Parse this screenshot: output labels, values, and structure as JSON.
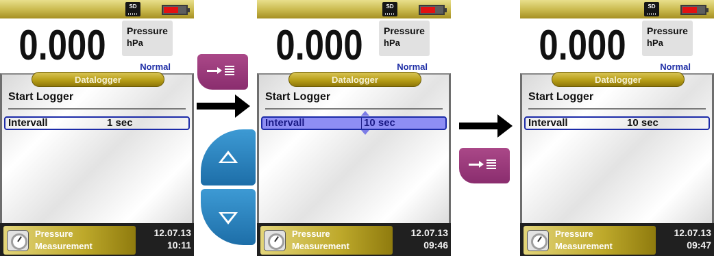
{
  "screens": [
    {
      "sd_label": "SD",
      "reading": "0.000",
      "unit_name": "Pressure",
      "unit": "hPa",
      "mode": "Normal",
      "menu_tab": "Datalogger",
      "menu_title": "Start Logger",
      "row_label": "Intervall",
      "row_value": "1 sec",
      "row_state": "selected",
      "status_line1": "Pressure",
      "status_line2": "Measurement",
      "date": "12.07.13",
      "time": "10:11"
    },
    {
      "sd_label": "SD",
      "reading": "0.000",
      "unit_name": "Pressure",
      "unit": "hPa",
      "mode": "Normal",
      "menu_tab": "Datalogger",
      "menu_title": "Start Logger",
      "row_label": "Intervall",
      "row_value": "10 sec",
      "row_state": "editing",
      "status_line1": "Pressure",
      "status_line2": "Measurement",
      "date": "12.07.13",
      "time": "09:46"
    },
    {
      "sd_label": "SD",
      "reading": "0.000",
      "unit_name": "Pressure",
      "unit": "hPa",
      "mode": "Normal",
      "menu_tab": "Datalogger",
      "menu_title": "Start Logger",
      "row_label": "Intervall",
      "row_value": "10 sec",
      "row_state": "selected",
      "status_line1": "Pressure",
      "status_line2": "Measurement",
      "date": "12.07.13",
      "time": "09:47"
    }
  ],
  "battery_level": 0.62,
  "colors": {
    "title_gold": "#c9b84c",
    "selection_blue": "#1b2aa8",
    "edit_fill": "#8e8ef4",
    "enter_key": "#9a3a7b",
    "arrow_key": "#2a86c3",
    "battery_red": "#e11212"
  },
  "keys": {
    "enter_icon": "enter-icon",
    "up_icon": "arrow-up-icon",
    "down_icon": "arrow-down-icon"
  }
}
